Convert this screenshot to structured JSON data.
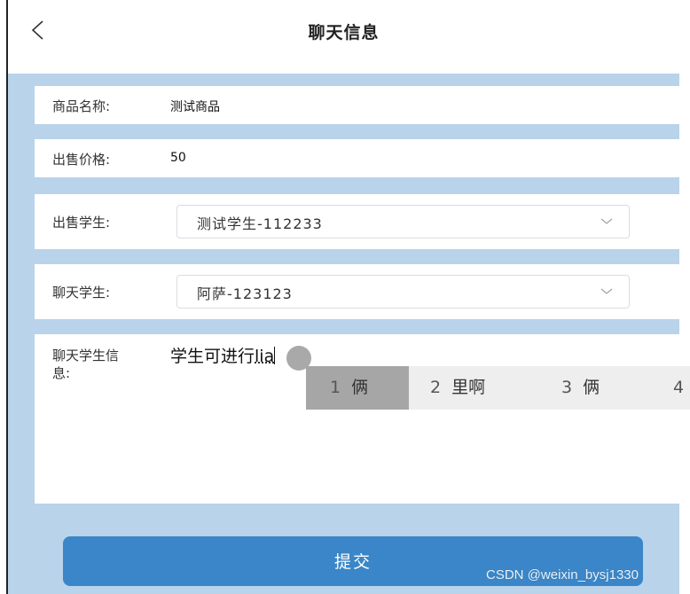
{
  "header": {
    "back_icon": "chevron-left-icon",
    "title": "聊天信息"
  },
  "form": {
    "product_name": {
      "label": "商品名称:",
      "value": "测试商品"
    },
    "sale_price": {
      "label": "出售价格:",
      "value": "50"
    },
    "seller": {
      "label": "出售学生:",
      "selected": "测试学生-112233",
      "icon": "chevron-down-icon"
    },
    "chat_student": {
      "label": "聊天学生:",
      "selected": "阿萨-123123",
      "icon": "chevron-down-icon"
    },
    "message": {
      "label": "聊天学生信息:",
      "committed_text": "学生可进行",
      "composing_text": "lia"
    },
    "submit_label": "提交"
  },
  "ime": {
    "candidates": [
      {
        "num": "1",
        "text": "俩",
        "selected": true
      },
      {
        "num": "2",
        "text": "里啊",
        "selected": false
      },
      {
        "num": "3",
        "text": "俩",
        "selected": false
      },
      {
        "num": "4",
        "text": "",
        "selected": false
      }
    ]
  },
  "watermark": "CSDN @weixin_bysj1330",
  "colors": {
    "background": "#b9d3ea",
    "submit_button": "#3a86c8",
    "ime_selected": "#a6a6a6"
  }
}
